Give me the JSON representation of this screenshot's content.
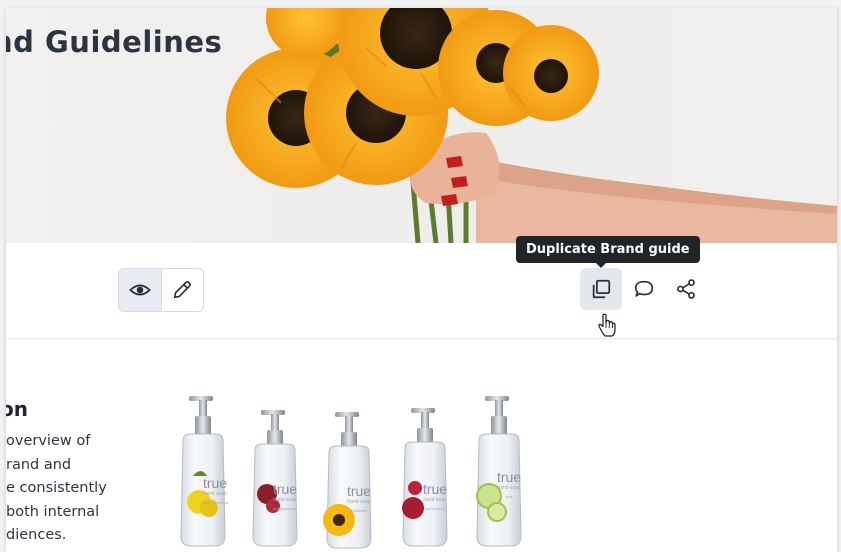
{
  "hero": {
    "title": "nd Guidelines"
  },
  "toolbar": {
    "view_toggle": {
      "view_icon": "eye-icon",
      "edit_icon": "pencil-icon",
      "active": "view"
    },
    "actions": [
      {
        "icon": "duplicate-icon",
        "name": "Duplicate Brand guide"
      },
      {
        "icon": "comment-icon",
        "name": "Comment"
      },
      {
        "icon": "share-icon",
        "name": "Share"
      }
    ],
    "tooltip": "Duplicate Brand guide"
  },
  "section": {
    "heading": "on",
    "lines": [
      "overview of",
      "rand and",
      "e consistently",
      "both internal",
      "diences."
    ]
  },
  "products": {
    "brand": "true",
    "subtitle": "hand soap",
    "variants": [
      "lemon verbena",
      "pomegranate",
      "sunflower",
      "sweet berry",
      "lime"
    ]
  },
  "colors": {
    "tooltip_bg": "#222528",
    "active_toggle_bg": "#e8ecf1",
    "hover_bg": "#e4e8ed",
    "petal": "#f4a51c",
    "heading": "#2b3440"
  }
}
